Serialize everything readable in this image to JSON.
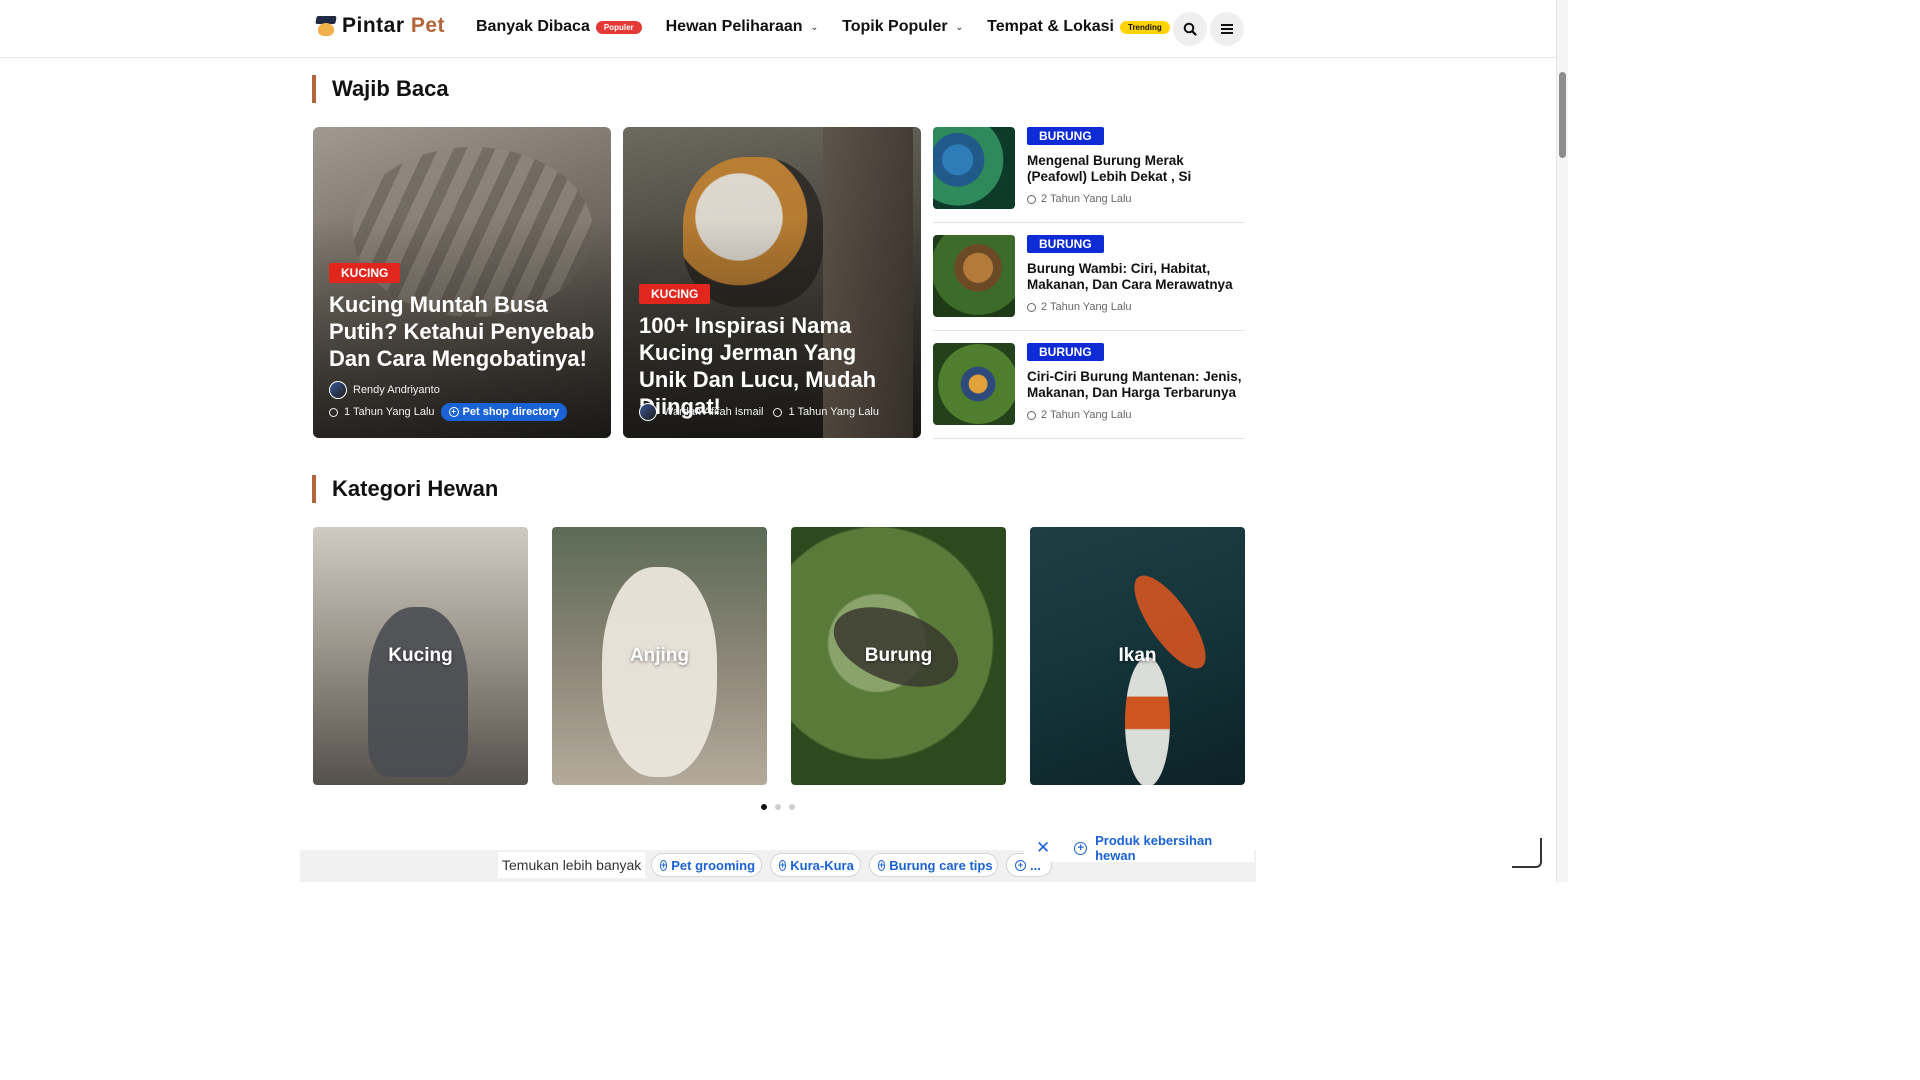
{
  "header": {
    "logo_part1": "Pintar",
    "logo_part2": "Pet",
    "nav": [
      {
        "label": "Banyak Dibaca",
        "badge": "Populer"
      },
      {
        "label": "Hewan Peliharaan"
      },
      {
        "label": "Topik Populer"
      },
      {
        "label": "Tempat & Lokasi",
        "badge": "Trending"
      }
    ]
  },
  "featured": {
    "title": "Wajib Baca",
    "cards": [
      {
        "category": "KUCING",
        "title": "Kucing Muntah Busa Putih? Ketahui Penyebab Dan Cara Mengobatinya!",
        "author": "Rendy Andriyanto",
        "time": "1 Tahun Yang Lalu",
        "chip": "Pet shop directory"
      },
      {
        "category": "KUCING",
        "title": "100+ Inspirasi Nama Kucing Jerman Yang Unik Dan Lucu, Mudah Diingat!",
        "author": "Wardah Afifah Ismail",
        "time": "1 Tahun Yang Lalu"
      }
    ],
    "side": [
      {
        "category": "BURUNG",
        "title": "Mengenal Burung Merak (Peafowl) Lebih Dekat , Si Cantik...",
        "time": "2 Tahun Yang Lalu"
      },
      {
        "category": "BURUNG",
        "title": "Burung Wambi: Ciri, Habitat, Makanan, Dan Cara Merawatnya",
        "time": "2 Tahun Yang Lalu"
      },
      {
        "category": "BURUNG",
        "title": "Ciri-Ciri Burung Mantenan: Jenis, Makanan, Dan Harga Terbarunya",
        "time": "2 Tahun Yang Lalu"
      }
    ]
  },
  "categories": {
    "title": "Kategori Hewan",
    "items": [
      "Kucing",
      "Anjing",
      "Burung",
      "Ikan"
    ],
    "slider_dots": 3,
    "active_dot": 0
  },
  "ads": {
    "discover_label": "Temukan lebih banyak",
    "pills": [
      "Pet grooming",
      "Kura-Kura",
      "Burung care tips",
      "..."
    ],
    "promo": "Produk kebersihan hewan"
  },
  "colors": {
    "accent": "#b5653a",
    "category_red": "#e0261d",
    "category_blue": "#0f2bd6",
    "link_blue": "#1a63d6",
    "badge_populer": "#e53935",
    "badge_trending": "#ffd400"
  }
}
